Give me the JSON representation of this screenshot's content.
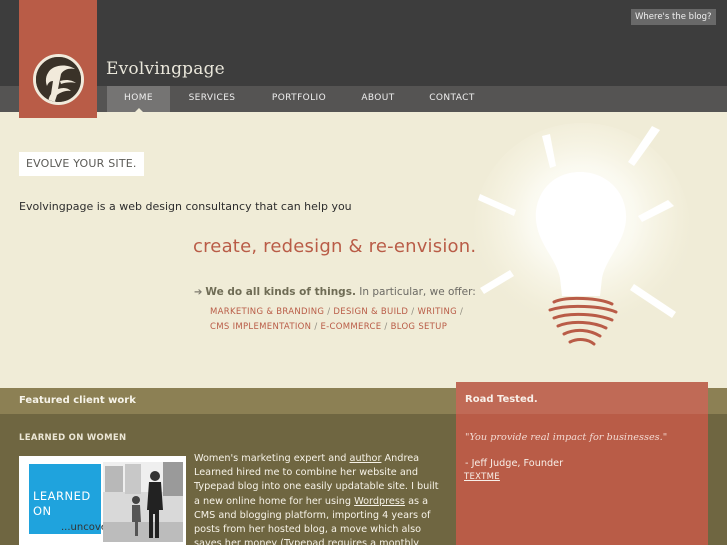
{
  "header": {
    "blog_link": "Where's the blog?",
    "site_name": "Evolvingpage",
    "logo_letter": "E"
  },
  "nav": {
    "items": [
      {
        "label": "HOME",
        "active": true
      },
      {
        "label": "SERVICES",
        "active": false
      },
      {
        "label": "PORTFOLIO",
        "active": false
      },
      {
        "label": "ABOUT",
        "active": false
      },
      {
        "label": "CONTACT",
        "active": false
      }
    ]
  },
  "hero": {
    "tag": "EVOLVE YOUR SITE.",
    "intro": "Evolvingpage is a web design consultancy that can help you",
    "tagline": "create, redesign & re-envision.",
    "offer_bold": "We do all kinds of things.",
    "offer_rest": " In particular, we offer:",
    "services": [
      "MARKETING & BRANDING",
      "DESIGN & BUILD",
      "WRITING",
      "CMS IMPLEMENTATION",
      "E-COMMERCE",
      "BLOG SETUP"
    ],
    "separator": " / "
  },
  "featured": {
    "title": "Featured client work",
    "client_title": "LEARNED ON WOMEN",
    "thumb_line1": "LEARNED",
    "thumb_line2": "ON",
    "thumb_line3": "...uncovering",
    "desc_part1": "Women's marketing expert and ",
    "desc_link1": "author",
    "desc_part2": " Andrea Learned hired me to combine her website and Typepad blog into one easily updatable site. I built a new online home for her using ",
    "desc_link2": "Wordpress",
    "desc_part3": " as a CMS and blogging platform, importing 4 years of posts from her hosted blog, a move which also saves her money (Typepad requires a monthly subscription fee)."
  },
  "testimonial": {
    "title": "Road Tested.",
    "quote": "\"You provide real impact for businesses.\"",
    "author": "- Jeff Judge, Founder",
    "company": "TEXTME"
  },
  "colors": {
    "accent": "#b95c47",
    "header": "#3d3d3d",
    "background": "#f0ecd7",
    "band": "#6f6641"
  }
}
